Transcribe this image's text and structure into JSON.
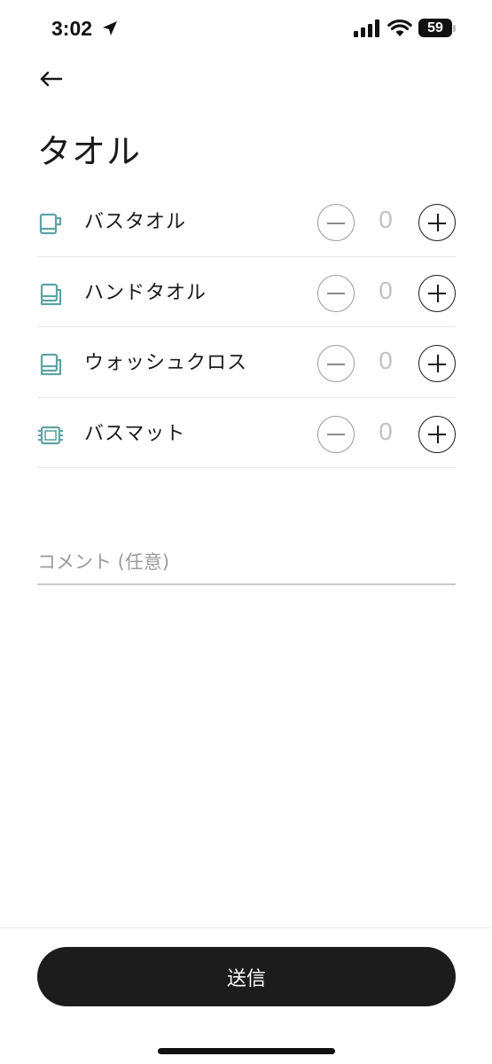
{
  "status_bar": {
    "time": "3:02",
    "battery": "59"
  },
  "header": {
    "title": "タオル"
  },
  "items": [
    {
      "label": "バスタオル",
      "quantity": "0",
      "icon": "bath-towel-icon"
    },
    {
      "label": "ハンドタオル",
      "quantity": "0",
      "icon": "hand-towel-icon"
    },
    {
      "label": "ウォッシュクロス",
      "quantity": "0",
      "icon": "washcloth-icon"
    },
    {
      "label": "バスマット",
      "quantity": "0",
      "icon": "bath-mat-icon"
    }
  ],
  "comment": {
    "placeholder": "コメント (任意)",
    "value": ""
  },
  "footer": {
    "submit_label": "送信"
  },
  "colors": {
    "accent_icon": "#5ea3a3",
    "button_bg": "#1c1c1c"
  }
}
